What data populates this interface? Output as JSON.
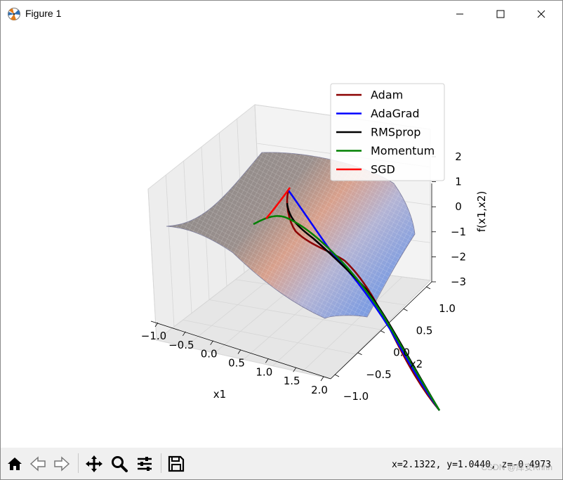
{
  "window": {
    "title": "Figure 1"
  },
  "toolbar": {
    "buttons": [
      "home-icon",
      "back-icon",
      "forward-icon",
      "pan-icon",
      "zoom-icon",
      "configure-subplots-icon",
      "save-icon"
    ],
    "coords": "x=2.1322, y=1.0440, z=-0.4973",
    "watermark": "CSDN @库安Khhh"
  },
  "colors": {
    "adam": "#8b0000",
    "adagrad": "#0000ff",
    "rmsprop": "#000000",
    "momentum": "#008000",
    "sgd": "#ff0000"
  },
  "chart_data": {
    "type": "surface",
    "xlabel": "x1",
    "ylabel": "x2",
    "zlabel": "f(x1,x2)",
    "xticks": [
      "−1.0",
      "−0.5",
      "0.0",
      "0.5",
      "1.0",
      "1.5",
      "2.0"
    ],
    "yticks": [
      "−1.0",
      "−0.5",
      "0.0",
      "0.5",
      "1.0"
    ],
    "zticks": [
      "2",
      "1",
      "0",
      "−1",
      "−2",
      "−3"
    ],
    "legend_position": "upper-right",
    "legend": [
      {
        "name": "Adam",
        "color": "#8b0000"
      },
      {
        "name": "AdaGrad",
        "color": "#0000ff"
      },
      {
        "name": "RMSprop",
        "color": "#000000"
      },
      {
        "name": "Momentum",
        "color": "#008000"
      },
      {
        "name": "SGD",
        "color": "#ff0000"
      }
    ],
    "grid": true
  }
}
